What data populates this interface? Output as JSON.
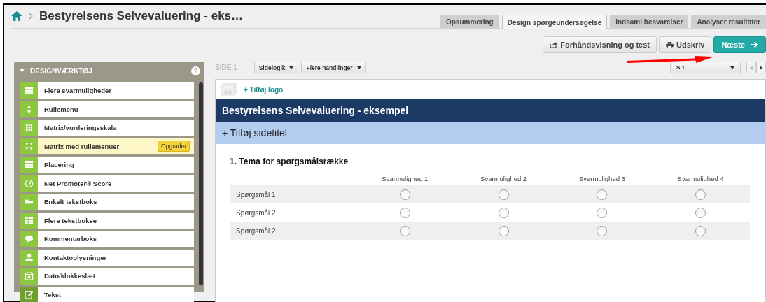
{
  "header": {
    "title": "Bestyrelsens Selvevaluering - eks…"
  },
  "tabs": [
    {
      "label": "Opsummering",
      "selected": false
    },
    {
      "label": "Design spørgeundersøgelse",
      "selected": true
    },
    {
      "label": "Indsaml besvarelser",
      "selected": false
    },
    {
      "label": "Analyser resultater",
      "selected": false
    }
  ],
  "toolbar": {
    "preview": "Forhåndsvisning og test",
    "print": "Udskriv",
    "next": "Næste"
  },
  "sidebar": {
    "title": "DESIGNVÆRKTØJ",
    "help": "?",
    "items": [
      {
        "label": "Flere svarmuligheder",
        "kind": "list"
      },
      {
        "label": "Rullemenu",
        "kind": "updown"
      },
      {
        "label": "Matrix/vurderingsskala",
        "kind": "grid"
      },
      {
        "label": "Matrix med rullemenuer",
        "kind": "matrixdrop",
        "badge": "Opgrader"
      },
      {
        "label": "Placering",
        "kind": "list"
      },
      {
        "label": "Net Promoter® Score",
        "kind": "gauge"
      },
      {
        "label": "Enkelt tekstboks",
        "kind": "textbox"
      },
      {
        "label": "Flere tekstbokse",
        "kind": "textboxes"
      },
      {
        "label": "Kommentarboks",
        "kind": "comment"
      },
      {
        "label": "Kontaktoplysninger",
        "kind": "person"
      },
      {
        "label": "Dato/klokkeslæt",
        "kind": "calendar"
      },
      {
        "label": "Tekst",
        "kind": "edit"
      }
    ]
  },
  "page_bar": {
    "label": "SIDE 1",
    "buttons": [
      "Sidelogik",
      "Flere handlinger"
    ],
    "page_select": "S.1"
  },
  "survey": {
    "add_logo": "+ Tilføj logo",
    "title": "Bestyrelsens Selvevaluering - eksempel",
    "add_page_title": "+ Tilføj sidetitel",
    "question": "1. Tema for spørgsmålsrække",
    "columns": [
      "Svarmulighed 1",
      "Svarmulighed 2",
      "Svarmulighed 3",
      "Svarmulighed 4"
    ],
    "rows": [
      {
        "label": "Spørgsmål 1",
        "answers": [
          {
            "selected": false
          },
          {
            "selected": false
          },
          {
            "selected": false
          },
          {
            "selected": false
          }
        ]
      },
      {
        "label": "Spørgsmål 2",
        "answers": [
          {
            "selected": false
          },
          {
            "selected": false
          },
          {
            "selected": false
          },
          {
            "selected": false
          }
        ]
      },
      {
        "label": "Spørgsmål 2",
        "answers": [
          {
            "selected": false
          },
          {
            "selected": false
          },
          {
            "selected": false
          },
          {
            "selected": false
          }
        ]
      }
    ]
  }
}
